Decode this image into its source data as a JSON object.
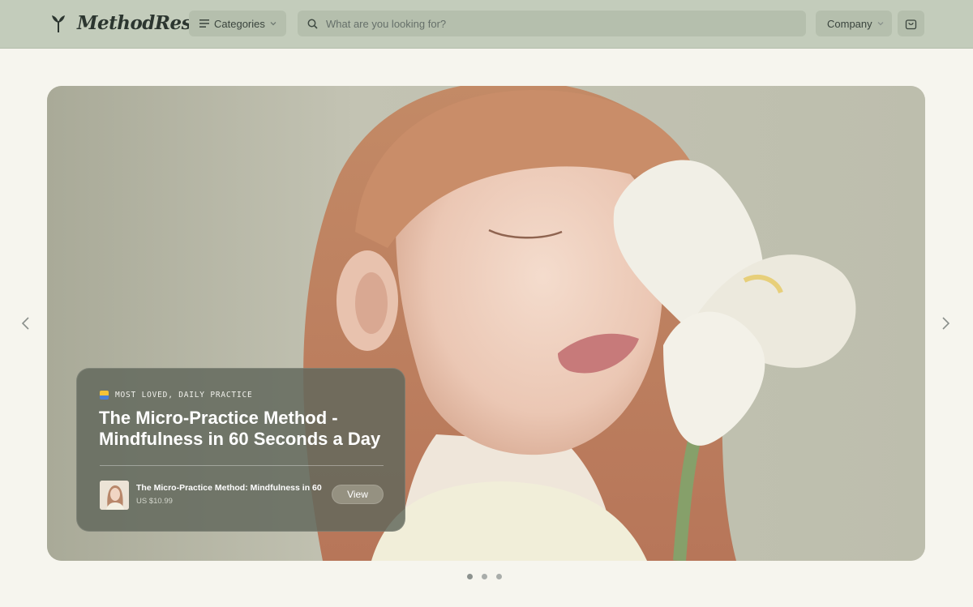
{
  "header": {
    "brand": "MethodRest",
    "brand_icon": "sprout-icon",
    "categories_label": "Categories",
    "search_placeholder": "What are you looking for?",
    "search_value": "",
    "company_label": "Company",
    "cart_icon": "shopping-bag-icon"
  },
  "hero": {
    "eyebrow": "MOST LOVED, DAILY PRACTICE",
    "title": "The Micro-Practice Method - Mindfulness in 60 Seconds a Day",
    "product": {
      "name": "The Micro-Practice Method: Mindfulness in 60",
      "price": "US $10.99",
      "view_label": "View"
    },
    "slides_total": 3,
    "active_slide": 1
  },
  "colors": {
    "header_bg": "#c3ccbb",
    "page_bg": "#f6f5ee",
    "card_bg": "#62685c",
    "accent_text": "#2c3630"
  }
}
